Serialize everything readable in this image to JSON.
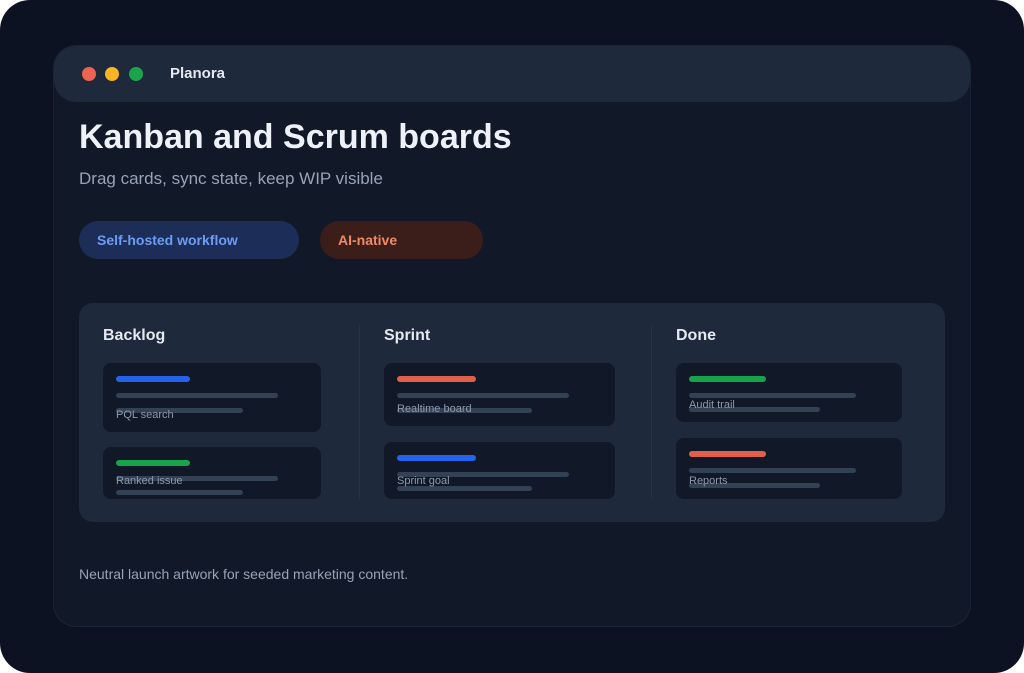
{
  "window": {
    "app_name": "Planora",
    "controls": [
      "close",
      "minimize",
      "maximize"
    ]
  },
  "hero": {
    "headline": "Kanban and Scrum boards",
    "subhead": "Drag cards, sync state, keep WIP visible"
  },
  "badges": [
    {
      "label": "Self-hosted workflow",
      "color": "#6d9cf2"
    },
    {
      "label": "AI-native",
      "color": "#f08a67"
    }
  ],
  "board": {
    "columns": [
      {
        "title": "Backlog",
        "cards": [
          {
            "label": "PQL search",
            "tag_color": "#2563eb"
          },
          {
            "label": "Ranked issue",
            "tag_color": "#16a34a"
          }
        ]
      },
      {
        "title": "Sprint",
        "cards": [
          {
            "label": "Realtime board",
            "tag_color": "#e2604b"
          },
          {
            "label": "Sprint goal",
            "tag_color": "#2563eb"
          }
        ]
      },
      {
        "title": "Done",
        "cards": [
          {
            "label": "Audit trail",
            "tag_color": "#16a34a"
          },
          {
            "label": "Reports",
            "tag_color": "#e2604b"
          }
        ]
      }
    ]
  },
  "footer": {
    "note": "Neutral launch artwork for seeded marketing content."
  }
}
